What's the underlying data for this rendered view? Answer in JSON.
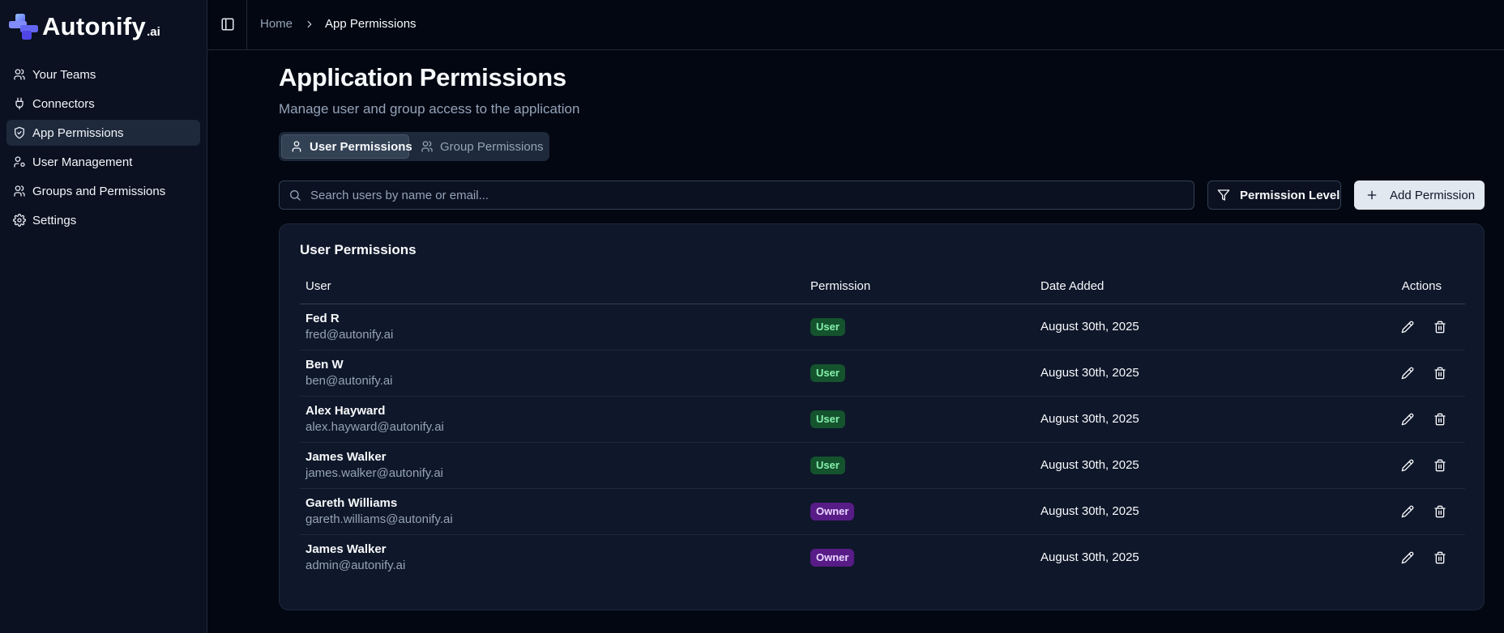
{
  "brand": {
    "name": "Autonify",
    "suffix": ".ai"
  },
  "sidebar": {
    "items": [
      {
        "label": "Your Teams",
        "icon": "users-icon"
      },
      {
        "label": "Connectors",
        "icon": "plug-icon"
      },
      {
        "label": "App Permissions",
        "icon": "shield-icon",
        "active": true
      },
      {
        "label": "User Management",
        "icon": "user-cog-icon"
      },
      {
        "label": "Groups and Permissions",
        "icon": "users-icon"
      },
      {
        "label": "Settings",
        "icon": "gear-icon"
      }
    ]
  },
  "breadcrumb": {
    "home": "Home",
    "current": "App Permissions"
  },
  "page": {
    "title": "Application Permissions",
    "subtitle": "Manage user and group access to the application"
  },
  "tabs": [
    {
      "label": "User Permissions",
      "active": true
    },
    {
      "label": "Group Permissions",
      "active": false
    }
  ],
  "search": {
    "placeholder": "Search users by name or email...",
    "value": ""
  },
  "filter": {
    "label": "Permission Level"
  },
  "add_button": {
    "label": "Add Permission"
  },
  "table": {
    "title": "User Permissions",
    "columns": [
      "User",
      "Permission",
      "Date Added",
      "Actions"
    ],
    "rows": [
      {
        "name": "Fed R",
        "email": "fred@autonify.ai",
        "permission": "User",
        "date": "August 30th, 2025"
      },
      {
        "name": "Ben W",
        "email": "ben@autonify.ai",
        "permission": "User",
        "date": "August 30th, 2025"
      },
      {
        "name": "Alex Hayward",
        "email": "alex.hayward@autonify.ai",
        "permission": "User",
        "date": "August 30th, 2025"
      },
      {
        "name": "James Walker",
        "email": "james.walker@autonify.ai",
        "permission": "User",
        "date": "August 30th, 2025"
      },
      {
        "name": "Gareth Williams",
        "email": "gareth.williams@autonify.ai",
        "permission": "Owner",
        "date": "August 30th, 2025"
      },
      {
        "name": "James Walker",
        "email": "admin@autonify.ai",
        "permission": "Owner",
        "date": "August 30th, 2025"
      }
    ]
  },
  "colors": {
    "background": "#030712",
    "sidebar": "#0b1120",
    "card": "#0f172a",
    "user_badge_bg": "#14532d",
    "user_badge_text": "#86efac",
    "owner_badge_bg": "#581c87",
    "owner_badge_text": "#e9d5ff",
    "logo_accent": "#6366f1"
  }
}
